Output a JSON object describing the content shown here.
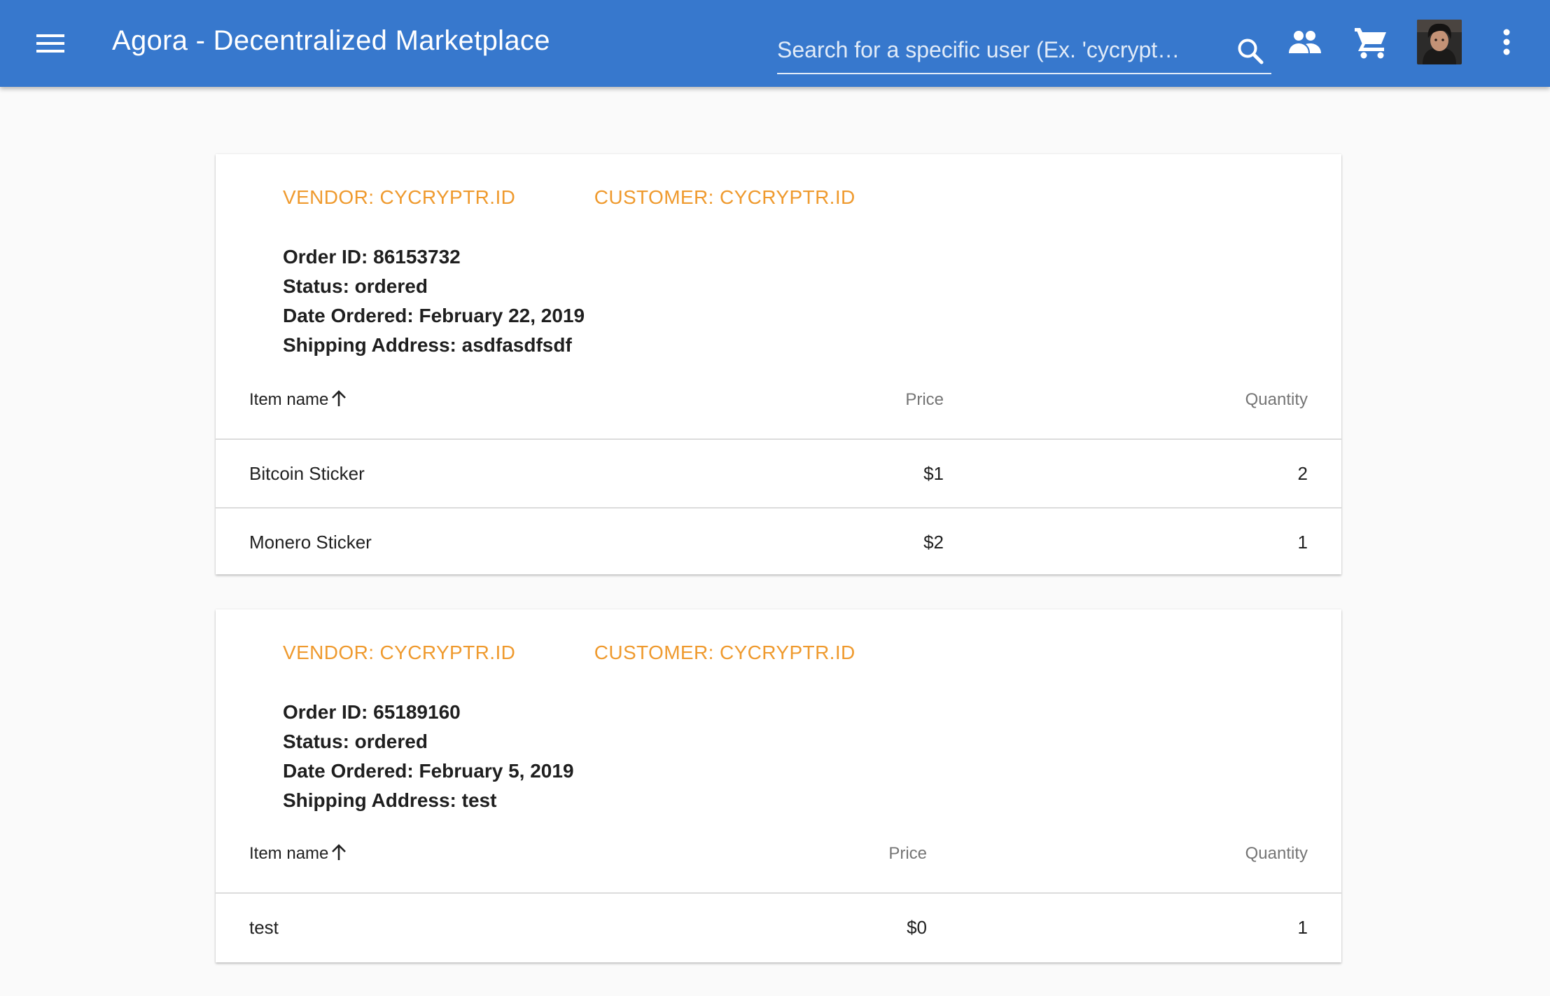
{
  "appbar": {
    "title": "Agora - Decentralized Marketplace",
    "search_placeholder": "Search for a specific user (Ex. 'cycrypt…",
    "icons": {
      "menu": "menu-icon",
      "search": "search-icon",
      "users": "people-icon",
      "cart": "shopping-cart-icon",
      "more": "more-vert-icon"
    },
    "color": "#3778cd"
  },
  "accent_color": "#ef9a2e",
  "table_headers": {
    "item_name": "Item name",
    "price": "Price",
    "quantity": "Quantity"
  },
  "orders": [
    {
      "vendor": "VENDOR: CYCRYPTR.ID",
      "customer": "CUSTOMER: CYCRYPTR.ID",
      "order_id": "Order ID: 86153732",
      "status": "Status: ordered",
      "date_ordered": "Date Ordered: February 22, 2019",
      "shipping_address": "Shipping Address: asdfasdfsdf",
      "items": [
        {
          "name": "Bitcoin Sticker",
          "price": "$1",
          "quantity": "2"
        },
        {
          "name": "Monero Sticker",
          "price": "$2",
          "quantity": "1"
        }
      ]
    },
    {
      "vendor": "VENDOR: CYCRYPTR.ID",
      "customer": "CUSTOMER: CYCRYPTR.ID",
      "order_id": "Order ID: 65189160",
      "status": "Status: ordered",
      "date_ordered": "Date Ordered: February 5, 2019",
      "shipping_address": "Shipping Address: test",
      "items": [
        {
          "name": "test",
          "price": "$0",
          "quantity": "1"
        }
      ]
    }
  ]
}
